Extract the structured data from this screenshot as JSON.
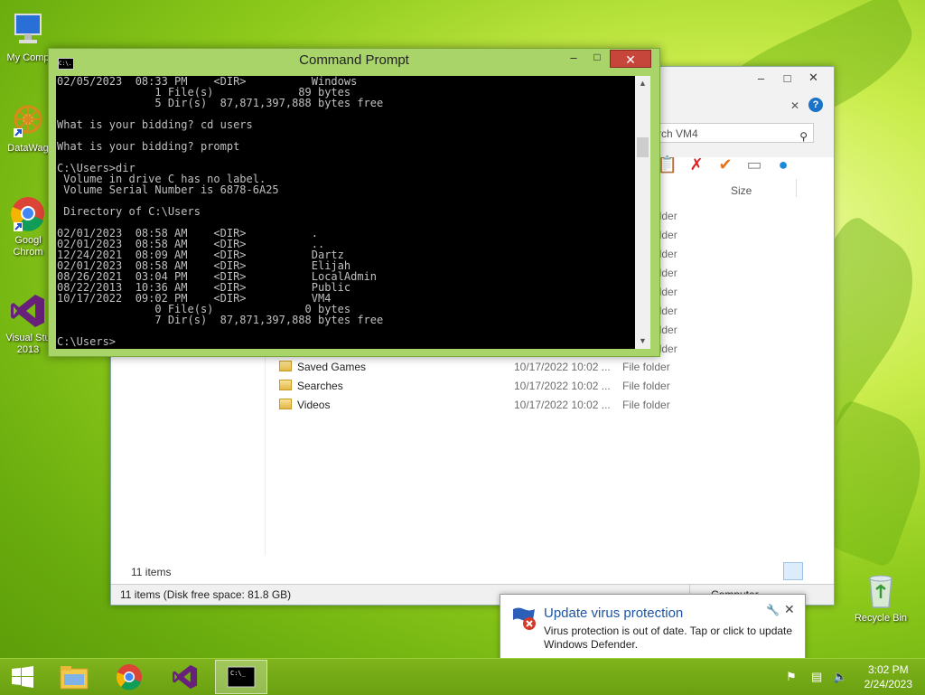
{
  "desktop": {
    "icons": [
      {
        "label": "My Comp",
        "icon": "computer-icon"
      },
      {
        "label": "DataWag",
        "icon": "datawag-icon"
      },
      {
        "label": "Googl Chrom",
        "icon": "chrome-icon"
      },
      {
        "label": "Visual Stu 2013",
        "icon": "visual-studio-icon"
      }
    ],
    "recycle_bin": {
      "label": "Recycle Bin",
      "icon": "recycle-bin-icon"
    }
  },
  "explorer": {
    "search_placeholder": "rch VM4",
    "column_size": "Size",
    "partial_rows": [
      "older",
      "older",
      "older",
      "older",
      "older",
      "older",
      "older",
      "older"
    ],
    "rows": [
      {
        "name": "Saved Games",
        "date": "10/17/2022 10:02 ...",
        "type": "File folder",
        "icon": "folder-icon"
      },
      {
        "name": "Searches",
        "date": "10/17/2022 10:02 ...",
        "type": "File folder",
        "icon": "folder-icon"
      },
      {
        "name": "Videos",
        "date": "10/17/2022 10:02 ...",
        "type": "File folder",
        "icon": "folder-icon"
      }
    ],
    "item_count": "11 items",
    "status_left": "11 items (Disk free space: 81.8 GB)",
    "status_right": "Computer"
  },
  "cmd": {
    "title": "Command Prompt",
    "icon_text": "C:\\.",
    "lines": [
      "02/05/2023  08:33 PM    <DIR>          Windows",
      "               1 File(s)             89 bytes",
      "               5 Dir(s)  87,871,397,888 bytes free",
      "",
      "What is your bidding? cd users",
      "",
      "What is your bidding? prompt",
      "",
      "C:\\Users>dir",
      " Volume in drive C has no label.",
      " Volume Serial Number is 6878-6A25",
      "",
      " Directory of C:\\Users",
      "",
      "02/01/2023  08:58 AM    <DIR>          .",
      "02/01/2023  08:58 AM    <DIR>          ..",
      "12/24/2021  08:09 AM    <DIR>          Dartz",
      "02/01/2023  08:58 AM    <DIR>          Elijah",
      "08/26/2021  03:04 PM    <DIR>          LocalAdmin",
      "08/22/2013  10:36 AM    <DIR>          Public",
      "10/17/2022  09:02 PM    <DIR>          VM4",
      "               0 File(s)              0 bytes",
      "               7 Dir(s)  87,871,397,888 bytes free",
      "",
      "C:\\Users>"
    ]
  },
  "toast": {
    "title": "Update virus protection",
    "message": "Virus protection is out of date. Tap or click to update Windows Defender."
  },
  "taskbar": {
    "time": "3:02 PM",
    "date": "2/24/2023",
    "items": [
      "start-button",
      "file-explorer",
      "chrome",
      "visual-studio",
      "command-prompt"
    ]
  },
  "colors": {
    "cmd_frame": "#a9d46a",
    "close_red": "#c7463b",
    "toast_title": "#1b55a8",
    "taskbar": "#6aa010"
  }
}
